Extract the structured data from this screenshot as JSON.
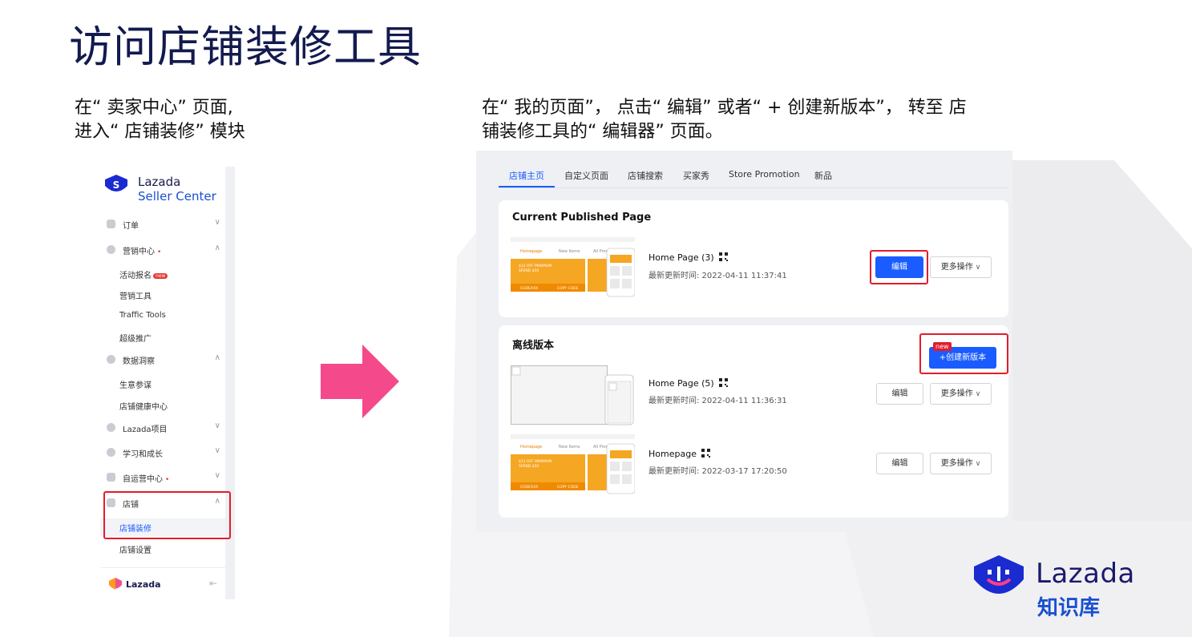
{
  "title": "访问店铺装修工具",
  "captions": {
    "left_line1": "在“ 卖家中心” 页面,",
    "left_line2": "进入“ 店铺装修” 模块",
    "right_line1": "在“ 我的页面”， 点击“ 编辑” 或者“ + 创建新版本”， 转至 店",
    "right_line2": "铺装修工具的“ 编辑器” 页面。"
  },
  "sidebar": {
    "brand_line1": "Lazada",
    "brand_line2": "Seller Center",
    "items": [
      {
        "label": "订单",
        "chevron": "∨"
      },
      {
        "label": "营销中心",
        "chevron": "∧",
        "dot": "•"
      },
      {
        "sub": "活动报名",
        "badge": "new"
      },
      {
        "sub": "营销工具"
      },
      {
        "sub": "Traffic Tools"
      },
      {
        "sub": "超级推广"
      },
      {
        "label": "数据洞察",
        "chevron": "∧"
      },
      {
        "sub": "生意参谋"
      },
      {
        "sub": "店铺健康中心"
      },
      {
        "label": "Lazada项目",
        "chevron": "∨"
      },
      {
        "label": "学习和成长",
        "chevron": "∨"
      },
      {
        "label": "自运营中心",
        "chevron": "∨",
        "dot": "•"
      },
      {
        "label": "店铺",
        "chevron": "∧"
      },
      {
        "sub": "店铺装修"
      },
      {
        "sub": "店铺设置"
      }
    ],
    "footer_brand": "Lazada",
    "footer_icon": "⇤"
  },
  "panel": {
    "tabs": [
      "店铺主页",
      "自定义页面",
      "店铺搜索",
      "买家秀",
      "Store Promotion",
      "新品"
    ],
    "published": {
      "title": "Current Published Page",
      "page_name": "Home Page (3)",
      "updated": "最新更新时间: 2022-04-11 11:37:41",
      "edit_label": "编辑",
      "more_label": "更多操作"
    },
    "offline": {
      "title": "离线版本",
      "new_tag": "new",
      "create_label": "+创建新版本",
      "rows": [
        {
          "page_name": "Home Page (5)",
          "updated": "最新更新时间: 2022-04-11 11:36:31",
          "edit_label": "编辑",
          "more_label": "更多操作"
        },
        {
          "page_name": "Homepage",
          "updated": "最新更新时间: 2022-03-17 17:20:50",
          "edit_label": "编辑",
          "more_label": "更多操作"
        }
      ]
    },
    "thumb_text": {
      "tab1": "Homepage",
      "tab2": "New Items",
      "tab3": "All Products",
      "promo1": "$12 OFF MINIMUM",
      "promo2": "SPEND $50",
      "code": "CODEXXX",
      "copy": "COPY CODE"
    }
  },
  "logo": {
    "word": "Lazada",
    "sub": "知识库"
  },
  "colors": {
    "accent": "#1a5cff",
    "highlight": "#e11d2b",
    "arrow": "#f44a8c",
    "title": "#131a4e"
  }
}
